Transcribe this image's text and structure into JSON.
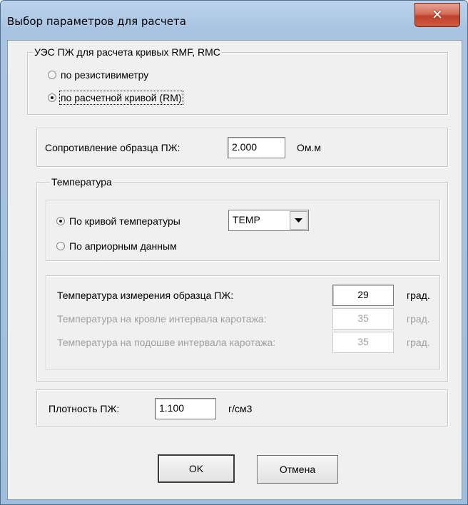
{
  "window": {
    "title": "Выбор параметров для расчета",
    "close_glyph": "✕"
  },
  "ues_group": {
    "legend": "УЭС ПЖ для расчета кривых RMF, RMC",
    "options": [
      {
        "label": "по резистивиметру",
        "checked": false
      },
      {
        "label": "по расчетной кривой (RM)",
        "checked": true
      }
    ]
  },
  "resistance": {
    "label": "Сопротивление образца ПЖ:",
    "value": "2.000",
    "unit": "Ом.м"
  },
  "temperature_group": {
    "legend": "Температура",
    "options": [
      {
        "label": "По кривой температуры",
        "checked": true
      },
      {
        "label": "По априорным данным",
        "checked": false
      }
    ],
    "curve_select": {
      "value": "TEMP"
    },
    "rows": [
      {
        "label": "Температура измерения образца ПЖ:",
        "value": "29",
        "unit": "град.",
        "enabled": true
      },
      {
        "label": "Температура на кровле интервала каротажа:",
        "value": "35",
        "unit": "град.",
        "enabled": false
      },
      {
        "label": "Температура на подошве интервала каротажа:",
        "value": "35",
        "unit": "град.",
        "enabled": false
      }
    ]
  },
  "density": {
    "label": "Плотность ПЖ:",
    "value": "1.100",
    "unit": "г/см3"
  },
  "buttons": {
    "ok": "OK",
    "cancel": "Отмена"
  }
}
